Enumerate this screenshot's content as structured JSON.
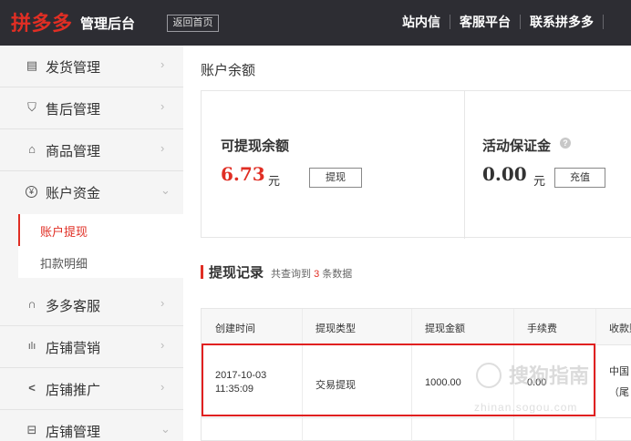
{
  "header": {
    "logo": "拼多多",
    "subtitle": "管理后台",
    "back_home": "返回首页",
    "nav": [
      "站内信",
      "客服平台",
      "联系拼多多"
    ]
  },
  "sidebar": {
    "items": [
      {
        "label": "发货管理",
        "icon": "document-icon",
        "glyph": "▤"
      },
      {
        "label": "售后管理",
        "icon": "shield-icon",
        "glyph": "⛉"
      },
      {
        "label": "商品管理",
        "icon": "bag-icon",
        "glyph": "⌂"
      },
      {
        "label": "账户资金",
        "icon": "yen-icon",
        "glyph": "¥"
      },
      {
        "label": "多多客服",
        "icon": "headset-icon",
        "glyph": "∩"
      },
      {
        "label": "店铺营销",
        "icon": "chart-icon",
        "glyph": "ılı"
      },
      {
        "label": "店铺推广",
        "icon": "share-icon",
        "glyph": "<"
      },
      {
        "label": "店铺管理",
        "icon": "store-icon",
        "glyph": "⊟"
      }
    ],
    "sub_items": [
      "账户提现",
      "扣款明细"
    ]
  },
  "main": {
    "title": "账户余额",
    "withdrawable": {
      "label": "可提现余额",
      "amount": "6.73",
      "unit": "元",
      "button": "提现"
    },
    "deposit": {
      "label": "活动保证金",
      "amount": "0.00",
      "unit": "元",
      "button": "充值"
    },
    "records": {
      "title": "提现记录",
      "count_prefix": "共查询到",
      "count": "3",
      "count_suffix": "条数据",
      "columns": [
        "创建时间",
        "提现类型",
        "提现金额",
        "手续费",
        "收款账"
      ],
      "rows": [
        {
          "date": "2017-10-03",
          "time": "11:35:09",
          "type": "交易提现",
          "amount": "1000.00",
          "fee": "0.00",
          "account_line1": "中国",
          "account_line2": "（尾"
        }
      ]
    }
  },
  "watermark": {
    "text": "搜狗指南",
    "sub": "zhinan.sogou.com"
  },
  "colors": {
    "brand": "#e02e24",
    "header_bg": "#2d2d33",
    "sidebar_bg": "#f5f5f5",
    "highlight": "#e02020"
  }
}
